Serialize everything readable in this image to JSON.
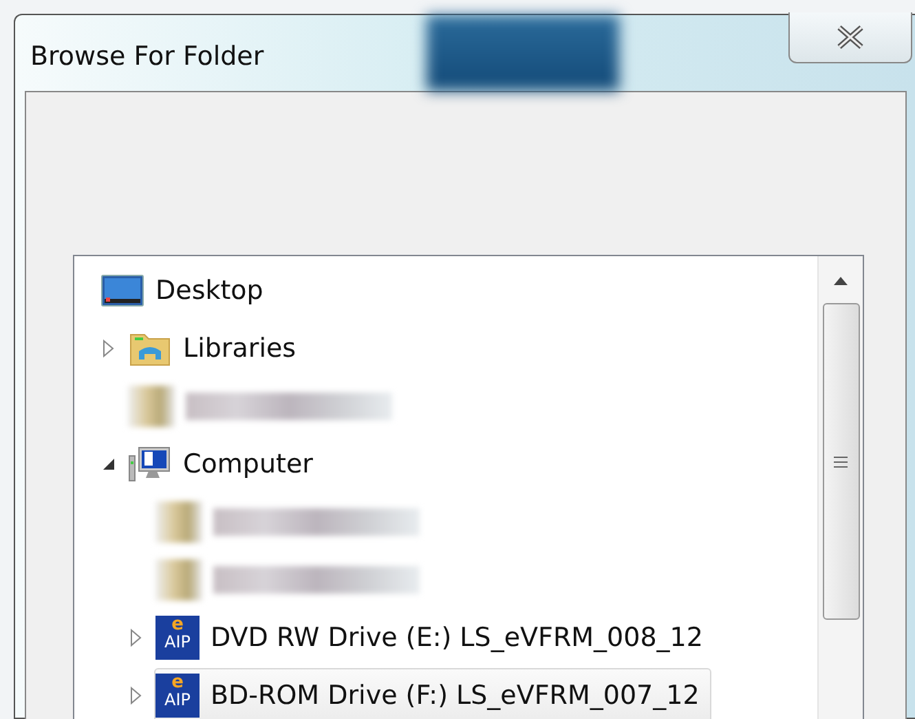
{
  "window": {
    "title": "Browse For Folder"
  },
  "tree": [
    {
      "kind": "desktop",
      "label": "Desktop",
      "selected": false,
      "children": [
        {
          "kind": "libraries",
          "label": "Libraries",
          "expanded": false,
          "selected": false
        },
        {
          "kind": "redacted",
          "selected": false
        },
        {
          "kind": "computer",
          "label": "Computer",
          "expanded": true,
          "selected": false,
          "children": [
            {
              "kind": "redacted",
              "selected": false
            },
            {
              "kind": "redacted",
              "selected": false
            },
            {
              "kind": "drive",
              "label": "DVD RW Drive (E:) LS_eVFRM_008_12",
              "icon_mark": "e",
              "icon_text": "AIP",
              "expanded": false,
              "selected": false
            },
            {
              "kind": "drive",
              "label": "BD-ROM Drive (F:) LS_eVFRM_007_12",
              "icon_mark": "e",
              "icon_text": "AIP",
              "expanded": false,
              "selected": true
            }
          ]
        }
      ]
    }
  ]
}
